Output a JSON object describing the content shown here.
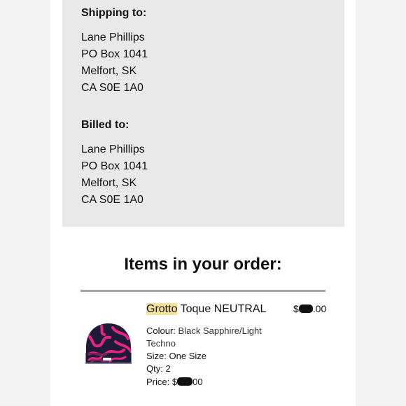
{
  "shipping": {
    "label": "Shipping to:",
    "lines": [
      "Lane Phillips",
      "PO Box 1041",
      "Melfort, SK",
      "CA S0E 1A0"
    ]
  },
  "billing": {
    "label": "Billed to:",
    "lines": [
      "Lane Phillips",
      "PO Box 1041",
      "Melfort, SK",
      "CA S0E 1A0"
    ]
  },
  "items_heading": "Items in your order:",
  "item": {
    "brand": "Grotto",
    "name": " Toque NEUTRAL",
    "price_prefix": "$",
    "price_suffix": ".00",
    "colour_label": "Colour:",
    "colour_value_line1": "Black Sapphire/Light",
    "colour_value_line2": "Techno",
    "size_label": "Size:",
    "size_value": "One Size",
    "qty_label": "Qty:",
    "qty_value": "2",
    "price_label": "Price:",
    "line_price_prefix": "$",
    "line_price_suffix": "00",
    "image_icon": "toque-beanie-image",
    "colors": {
      "beanie_dark": "#1e1b3a",
      "beanie_pattern": "#e8237f"
    }
  }
}
